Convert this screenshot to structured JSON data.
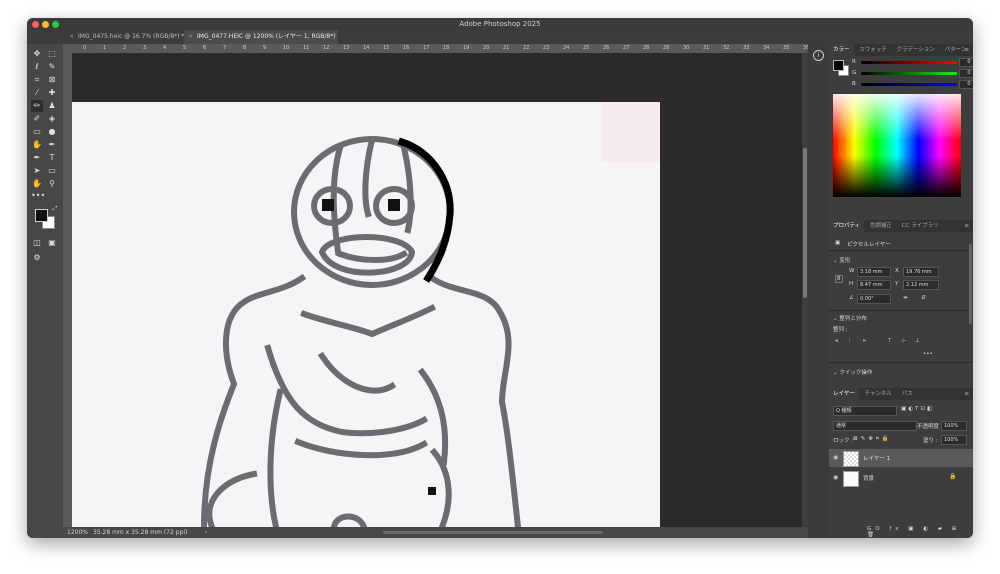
{
  "app": {
    "title": "Adobe Photoshop 2025"
  },
  "tabs": [
    {
      "label": "IMG_0475.heic @ 16.7% (RGB/8*) *",
      "active": false
    },
    {
      "label": "IMG_0477.HEIC @ 1200% (レイヤー 1, RGB/8*) *",
      "active": true
    }
  ],
  "ruler": {
    "ticks": [
      "0",
      "1",
      "2",
      "3",
      "4",
      "5",
      "6",
      "7",
      "8",
      "9",
      "10",
      "11",
      "12",
      "13",
      "14",
      "15",
      "16",
      "17",
      "18",
      "19",
      "20",
      "21",
      "22",
      "23",
      "24",
      "25",
      "26",
      "27",
      "28",
      "29",
      "30",
      "31",
      "32",
      "33",
      "34",
      "35",
      "36"
    ]
  },
  "status": {
    "zoom": "1200%",
    "doc_info": "35.28 mm x 35.28 mm (72 ppi)",
    "arrow": "›"
  },
  "color_panel": {
    "tabs": [
      "カラー",
      "スウォッチ",
      "グラデーション",
      "パターン"
    ],
    "channels": [
      {
        "label": "R",
        "value": "0",
        "color": "#ff0000"
      },
      {
        "label": "G",
        "value": "0",
        "color": "#00ff00"
      },
      {
        "label": "B",
        "value": "0",
        "color": "#0000ff"
      }
    ]
  },
  "properties": {
    "tabs": [
      "プロパティ",
      "色調補正",
      "CC ライブラリ"
    ],
    "layer_type": "ピクセルレイヤー",
    "transform_title": "変形",
    "w_label": "W",
    "w_value": "3.18 mm",
    "x_label": "X",
    "x_value": "19.76 mm",
    "h_label": "H",
    "h_value": "8.47 mm",
    "y_label": "Y",
    "y_value": "2.12 mm",
    "angle": "0.00°",
    "align_title": "整列と分布",
    "align_label": "整列 :",
    "more": "•••",
    "quick_title": "クイック操作"
  },
  "layers_panel": {
    "tabs": [
      "レイヤー",
      "チャンネル",
      "パス"
    ],
    "filter_label": "Q 種類",
    "blend_mode": "通常",
    "opacity_label": "不透明度 :",
    "opacity_value": "100%",
    "lock_label": "ロック :",
    "fill_label": "塗り :",
    "fill_value": "100%",
    "layers": [
      {
        "name": "レイヤー 1",
        "selected": true
      },
      {
        "name": "背景",
        "selected": false
      }
    ],
    "footer_icons": [
      "GO",
      "fx"
    ]
  },
  "colors": {
    "accent": "#1473e6",
    "panel_bg": "#3d3d3d",
    "canvas_bg": "#2a2a2a"
  }
}
